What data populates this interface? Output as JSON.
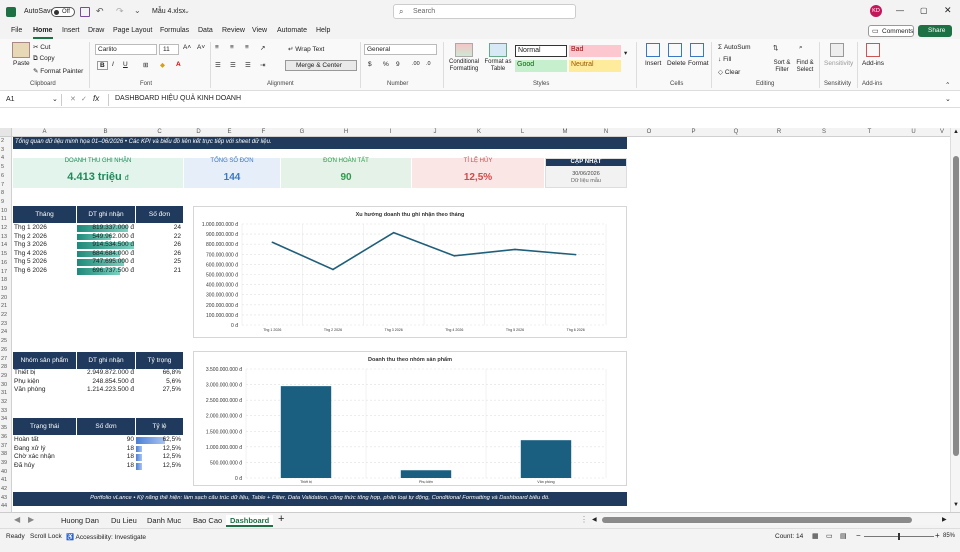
{
  "title": {
    "autosave": "AutoSave",
    "autosave_state": "Off",
    "filename": "Mẫu 4.xlsx",
    "search_placeholder": "Search",
    "avatar": "KD"
  },
  "menu": {
    "tabs": [
      "File",
      "Home",
      "Insert",
      "Draw",
      "Page Layout",
      "Formulas",
      "Data",
      "Review",
      "View",
      "Automate",
      "Help"
    ],
    "active": "Home",
    "comments": "Comments",
    "share": "Share"
  },
  "ribbon": {
    "paste": "Paste",
    "cut": "Cut",
    "copy": "Copy",
    "format_painter": "Format Painter",
    "clipboard": "Clipboard",
    "font_name": "Carlito",
    "font_size": "11",
    "font": "Font",
    "wrap_text": "Wrap Text",
    "merge_center": "Merge & Center",
    "alignment": "Alignment",
    "number_format": "General",
    "number": "Number",
    "conditional_formatting": "Conditional Formatting",
    "format_as_table": "Format as Table",
    "style_normal": "Normal",
    "style_bad": "Bad",
    "style_good": "Good",
    "style_neutral": "Neutral",
    "styles": "Styles",
    "insert": "Insert",
    "delete": "Delete",
    "format": "Format",
    "cells": "Cells",
    "autosum": "AutoSum",
    "fill": "Fill",
    "clear": "Clear",
    "sort_filter": "Sort & Filter",
    "find_select": "Find & Select",
    "editing": "Editing",
    "sensitivity": "Sensitivity",
    "addins": "Add-ins"
  },
  "formula_bar": {
    "name_box": "A1",
    "fx": "fx",
    "content": "DASHBOARD HIỆU QUẢ KINH DOANH"
  },
  "columns": [
    "A",
    "B",
    "C",
    "D",
    "E",
    "F",
    "G",
    "H",
    "I",
    "J",
    "K",
    "L",
    "M",
    "N",
    "O",
    "P",
    "Q",
    "R",
    "S",
    "T",
    "U",
    "V"
  ],
  "rows": [
    "2",
    "3",
    "4",
    "5",
    "6",
    "7",
    "8",
    "9",
    "10",
    "11",
    "12",
    "13",
    "14",
    "15",
    "16",
    "17",
    "18",
    "19",
    "20",
    "21",
    "22",
    "23",
    "24",
    "25",
    "26",
    "27",
    "28",
    "29",
    "30",
    "31",
    "32",
    "33",
    "34",
    "35",
    "36",
    "37",
    "38",
    "39",
    "40",
    "41",
    "42",
    "43",
    "44"
  ],
  "dashboard": {
    "subtitle": "Tổng quan dữ liệu minh họa 01–06/2026 • Các KPI và biểu đồ liên kết trực tiếp với sheet dữ liệu.",
    "kpis": [
      {
        "label": "DOANH THU GHI NHẬN",
        "value": "4.413 triệu",
        "unit": "đ",
        "color": "#1e8a5a",
        "bg": "#e3f4ec"
      },
      {
        "label": "TỔNG SỐ ĐƠN",
        "value": "144",
        "unit": "",
        "color": "#3a78c4",
        "bg": "#e6eff9"
      },
      {
        "label": "ĐƠN HOÀN TẤT",
        "value": "90",
        "unit": "",
        "color": "#2e9a4c",
        "bg": "#e4f2e7"
      },
      {
        "label": "TỈ LỆ HỦY",
        "value": "12,5%",
        "unit": "",
        "color": "#d24a4a",
        "bg": "#fbe6e6"
      }
    ],
    "update": {
      "label": "CẬP NHẬT",
      "date": "30/06/2026",
      "note": "Dữ liệu mẫu"
    },
    "month_table": {
      "headers": [
        "Tháng",
        "DT ghi nhận",
        "Số đơn"
      ],
      "rows": [
        {
          "month": "Thg 1 2026",
          "revenue": "819.337.000 đ",
          "orders": "24",
          "ratio": 0.89
        },
        {
          "month": "Thg 2 2026",
          "revenue": "549.962.000 đ",
          "orders": "22",
          "ratio": 0.6
        },
        {
          "month": "Thg 3 2026",
          "revenue": "914.534.500 đ",
          "orders": "26",
          "ratio": 1.0
        },
        {
          "month": "Thg 4 2026",
          "revenue": "684.684.000 đ",
          "orders": "26",
          "ratio": 0.75
        },
        {
          "month": "Thg 5 2026",
          "revenue": "747.695.000 đ",
          "orders": "25",
          "ratio": 0.82
        },
        {
          "month": "Thg 6 2026",
          "revenue": "696.737.500 đ",
          "orders": "21",
          "ratio": 0.76
        }
      ]
    },
    "group_table": {
      "headers": [
        "Nhóm sản phẩm",
        "DT ghi nhận",
        "Tỷ trọng"
      ],
      "rows": [
        {
          "group": "Thiết bị",
          "revenue": "2.949.872.000 đ",
          "share": "66,8%"
        },
        {
          "group": "Phụ kiện",
          "revenue": "248.854.500 đ",
          "share": "5,6%"
        },
        {
          "group": "Văn phòng",
          "revenue": "1.214.223.500 đ",
          "share": "27,5%"
        }
      ]
    },
    "status_table": {
      "headers": [
        "Trạng thái",
        "Số đơn",
        "Tỷ lệ"
      ],
      "rows": [
        {
          "status": "Hoàn tất",
          "count": "90",
          "rate": "62,5%",
          "ratio": 0.625
        },
        {
          "status": "Đang xử lý",
          "count": "18",
          "rate": "12,5%",
          "ratio": 0.125
        },
        {
          "status": "Chờ xác nhận",
          "count": "18",
          "rate": "12,5%",
          "ratio": 0.125
        },
        {
          "status": "Đã hủy",
          "count": "18",
          "rate": "12,5%",
          "ratio": 0.125
        }
      ]
    },
    "footer": "Portfolio vLance • Kỹ năng thể hiện: làm sạch cấu trúc dữ liệu, Table + Filter, Data Validation, công thức tổng hợp, phân loại tự động, Conditional Formatting và Dashboard biểu đồ."
  },
  "chart_data": [
    {
      "type": "line",
      "title": "Xu hướng doanh thu ghi nhận theo tháng",
      "categories": [
        "Thg 1 2026",
        "Thg 2 2026",
        "Thg 3 2026",
        "Thg 4 2026",
        "Thg 5 2026",
        "Thg 6 2026"
      ],
      "values": [
        819337000,
        549962000,
        914534500,
        684684000,
        747695000,
        696737500
      ],
      "yticks": [
        "1.000.000.000 đ",
        "900.000.000 đ",
        "800.000.000 đ",
        "700.000.000 đ",
        "600.000.000 đ",
        "500.000.000 đ",
        "400.000.000 đ",
        "300.000.000 đ",
        "200.000.000 đ",
        "100.000.000 đ",
        "0 đ"
      ],
      "ylim": [
        0,
        1000000000
      ],
      "color": "#1f5f7a"
    },
    {
      "type": "bar",
      "title": "Doanh thu theo nhóm sản phẩm",
      "categories": [
        "Thiết bị",
        "Phụ kiện",
        "Văn phòng"
      ],
      "values": [
        2949872000,
        248854500,
        1214223500
      ],
      "yticks": [
        "3.500.000.000 đ",
        "3.000.000.000 đ",
        "2.500.000.000 đ",
        "2.000.000.000 đ",
        "1.500.000.000 đ",
        "1.000.000.000 đ",
        "500.000.000 đ",
        "0 đ"
      ],
      "ylim": [
        0,
        3500000000
      ],
      "color": "#1a5e80"
    }
  ],
  "sheets": {
    "tabs": [
      "Huong Dan",
      "Du Lieu",
      "Danh Muc",
      "Bao Cao",
      "Dashboard"
    ],
    "active": "Dashboard"
  },
  "status": {
    "ready": "Ready",
    "scroll_lock": "Scroll Lock",
    "accessibility": "Accessibility: Investigate",
    "count": "Count: 14",
    "zoom": "85%"
  }
}
